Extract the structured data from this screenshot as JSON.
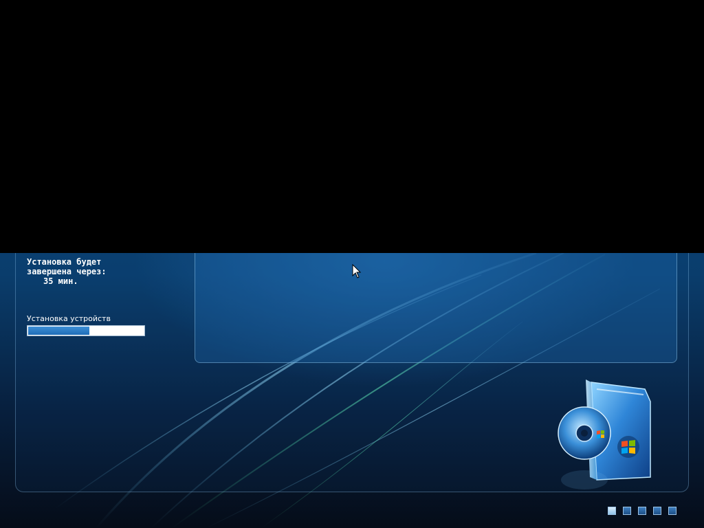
{
  "setup": {
    "time_remaining_line1": "Установка будет",
    "time_remaining_line2": "завершена через:",
    "time_remaining_value": "35 мин.",
    "current_stage_label": "Установка устройств",
    "progress_fraction": 0.53,
    "progress_color": "#1f6db8"
  },
  "pagination": {
    "total_steps": 5,
    "active_index": 0
  },
  "icons": {
    "product_box": "windows-install-box-icon",
    "cursor": "mouse-pointer-icon"
  }
}
